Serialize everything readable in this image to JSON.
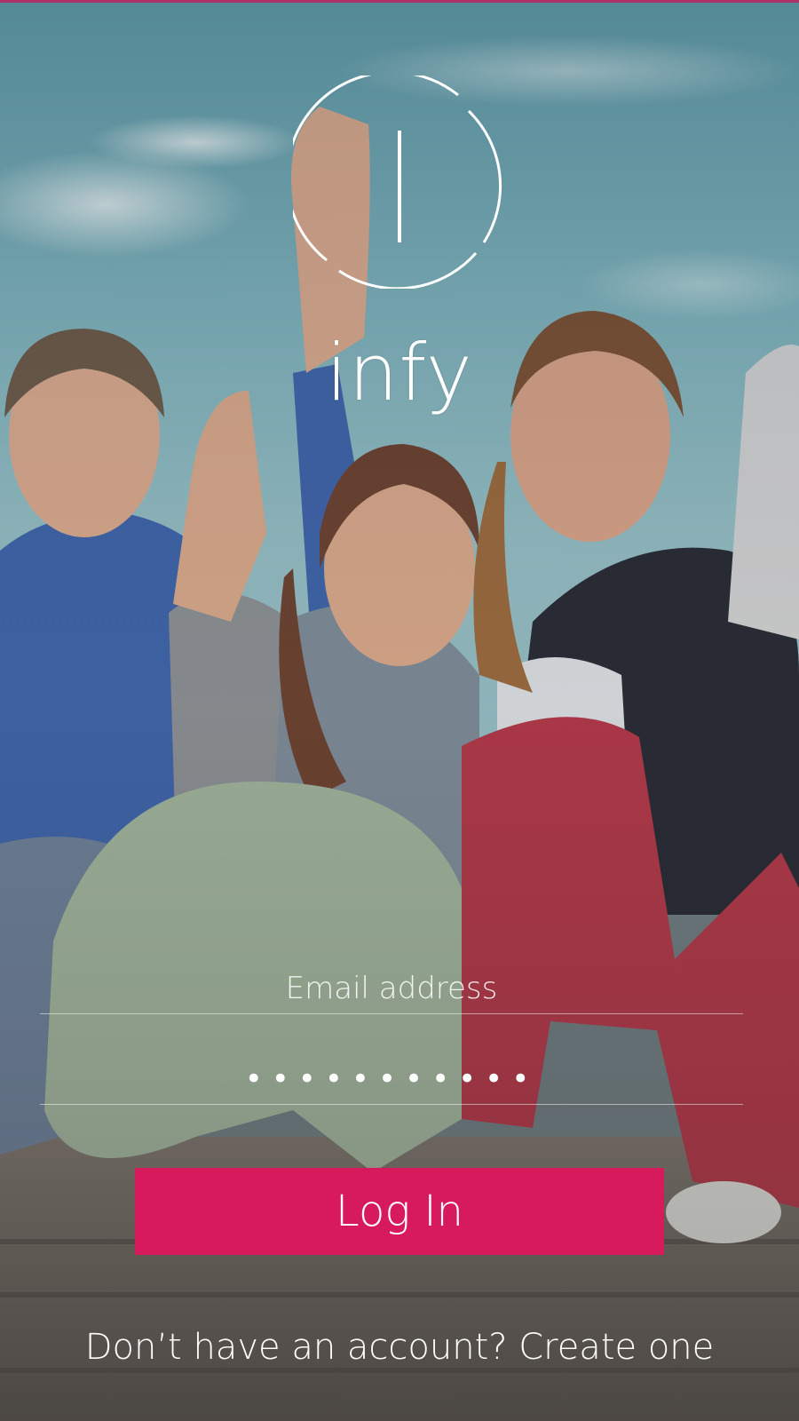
{
  "app": {
    "brand_name": "infy",
    "logo_icon": "power-circle-icon"
  },
  "background": {
    "subject": "friends-sitting-on-steps-photo"
  },
  "login_form": {
    "email_placeholder": "Email address",
    "password_mask": "•••••••••••",
    "login_label": "Log In"
  },
  "signup": {
    "prompt": "Don’t have an account?",
    "link_label": "Create one"
  },
  "colors": {
    "accent": "#d71a5c",
    "text": "#ffffff",
    "top_line": "#b0306a"
  }
}
